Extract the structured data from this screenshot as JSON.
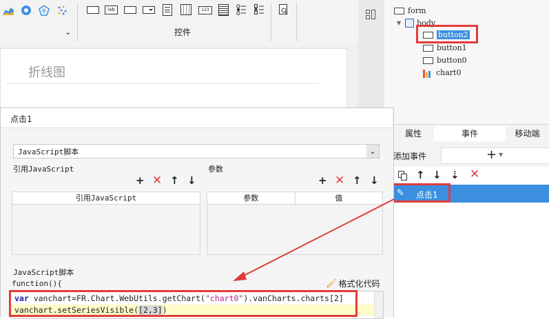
{
  "toolbar": {
    "group_label": "控件",
    "widget_icons": [
      "text-field-icon",
      "label-icon",
      "number-field-icon",
      "combo-box-icon",
      "file-icon",
      "date-icon",
      "password-icon",
      "text-area-icon",
      "radio-group-icon",
      "checkbox-group-icon",
      "search-icon"
    ],
    "lab_text": "lab",
    "num_text": "123"
  },
  "canvas": {
    "chart_title": "折线图"
  },
  "tree": {
    "items": [
      {
        "label": "form"
      },
      {
        "label": "body"
      },
      {
        "label": "button2"
      },
      {
        "label": "button1"
      },
      {
        "label": "button0"
      },
      {
        "label": "chart0"
      }
    ]
  },
  "dialog": {
    "title": "点击1",
    "script_type": "JavaScript脚本",
    "ref_js_section": "引用JavaScript",
    "params_section": "参数",
    "ref_js_col": "引用JavaScript",
    "param_col": "参数",
    "value_col": "值",
    "script_label": "JavaScript脚本",
    "function_header": "function(){",
    "format_code": "格式化代码",
    "code_line1_kw": "var",
    "code_line1_a": " vanchart=FR.Chart.WebUtils.getChart(",
    "code_line1_str": "\"chart0\"",
    "code_line1_b": ").vanCharts.charts[2]",
    "code_line2_a": "vanchart.setSeriesVisible(",
    "code_line2_b": "[2,3]",
    "code_line2_c": ")"
  },
  "panel": {
    "tabs": [
      "属性",
      "事件",
      "移动端"
    ],
    "add_event": "添加事件",
    "event_item": "点击1"
  },
  "colors": {
    "accent": "#3c8fdf",
    "highlight": "#e23b3b",
    "selected": "#3c8fdf",
    "code_bg": "#fffbc8"
  }
}
